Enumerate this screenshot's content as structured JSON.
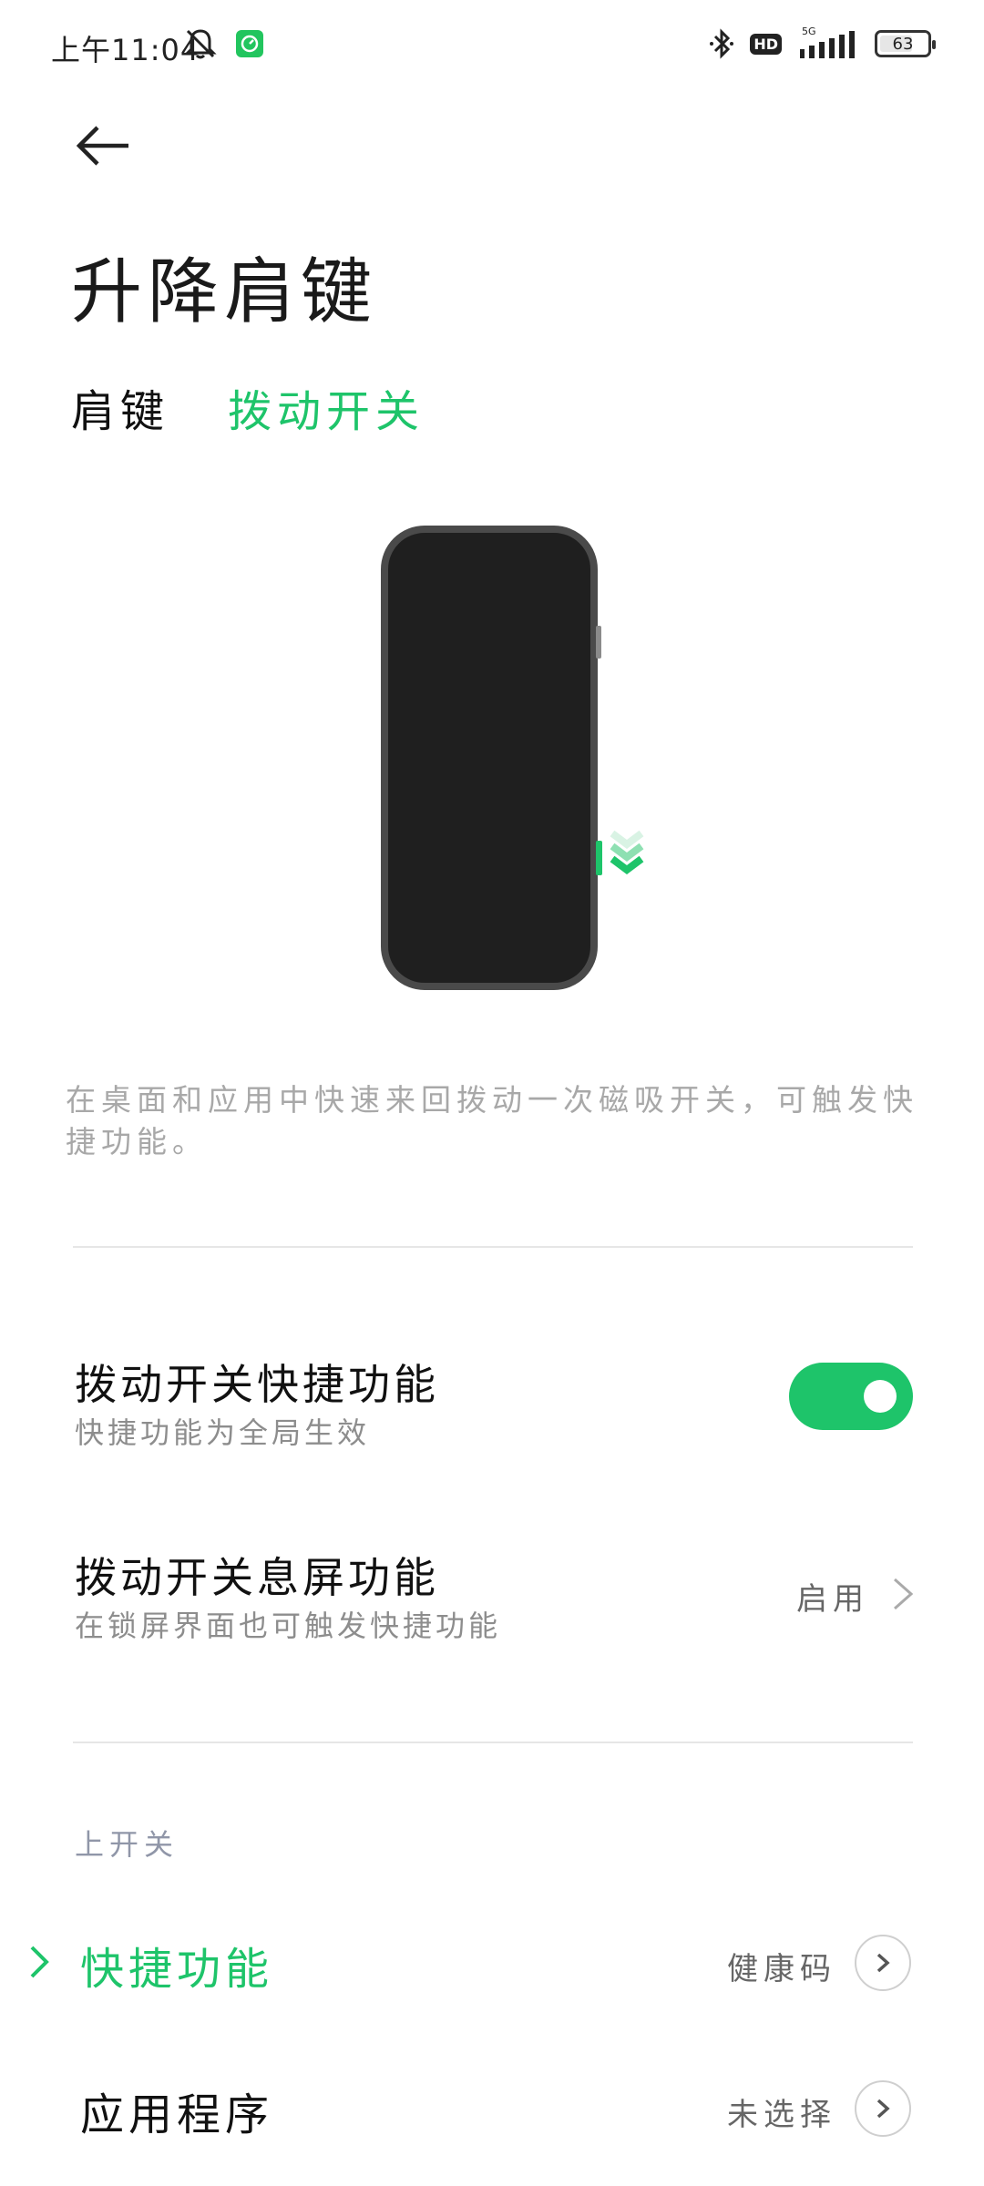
{
  "status_bar": {
    "time": "上午11:04",
    "battery": "63"
  },
  "header": {
    "title": "升降肩键"
  },
  "tabs": [
    {
      "label": "肩键",
      "active": false
    },
    {
      "label": "拨动开关",
      "active": true
    }
  ],
  "description": "在桌面和应用中快速来回拨动一次磁吸开关，可触发快捷功能。",
  "settings": {
    "shortcut": {
      "title": "拨动开关快捷功能",
      "subtitle": "快捷功能为全局生效",
      "enabled": true
    },
    "screen_off": {
      "title": "拨动开关息屏功能",
      "subtitle": "在锁屏界面也可触发快捷功能",
      "value": "启用"
    }
  },
  "section": {
    "label": "上开关",
    "rows": [
      {
        "title": "快捷功能",
        "value": "健康码",
        "selected": true
      },
      {
        "title": "应用程序",
        "value": "未选择",
        "selected": false
      }
    ]
  },
  "colors": {
    "accent": "#1ec46a",
    "text": "#1a1a1a",
    "muted": "#8d8d8d"
  }
}
